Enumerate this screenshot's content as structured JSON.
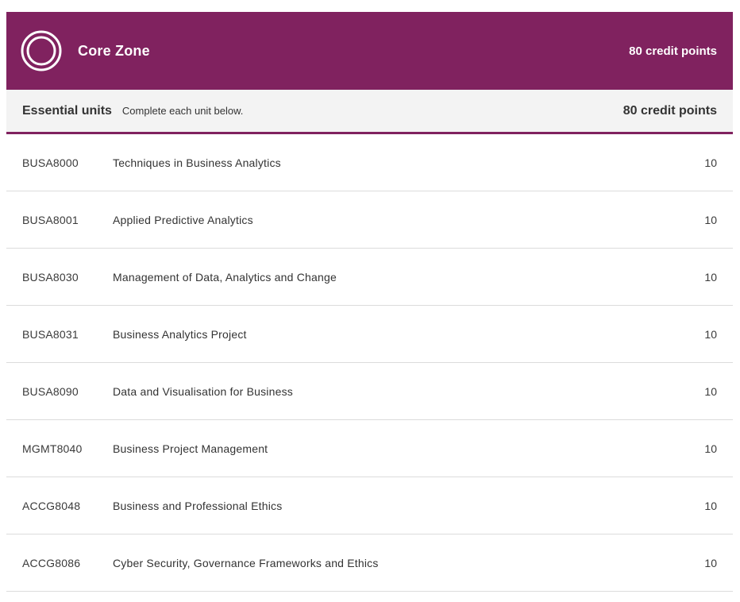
{
  "zone": {
    "title": "Core Zone",
    "credit_points": "80 credit points",
    "icon": "double-ring-icon",
    "accent_color": "#80225f"
  },
  "essential": {
    "title": "Essential units",
    "description": "Complete each unit below.",
    "credit_points": "80 credit points"
  },
  "units": [
    {
      "code": "BUSA8000",
      "title": "Techniques in Business Analytics",
      "cp": "10"
    },
    {
      "code": "BUSA8001",
      "title": "Applied Predictive Analytics",
      "cp": "10"
    },
    {
      "code": "BUSA8030",
      "title": "Management of Data, Analytics and Change",
      "cp": "10"
    },
    {
      "code": "BUSA8031",
      "title": "Business Analytics Project",
      "cp": "10"
    },
    {
      "code": "BUSA8090",
      "title": "Data and Visualisation for Business",
      "cp": "10"
    },
    {
      "code": "MGMT8040",
      "title": "Business Project Management",
      "cp": "10"
    },
    {
      "code": "ACCG8048",
      "title": "Business and Professional Ethics",
      "cp": "10"
    },
    {
      "code": "ACCG8086",
      "title": "Cyber Security, Governance Frameworks and Ethics",
      "cp": "10"
    }
  ]
}
